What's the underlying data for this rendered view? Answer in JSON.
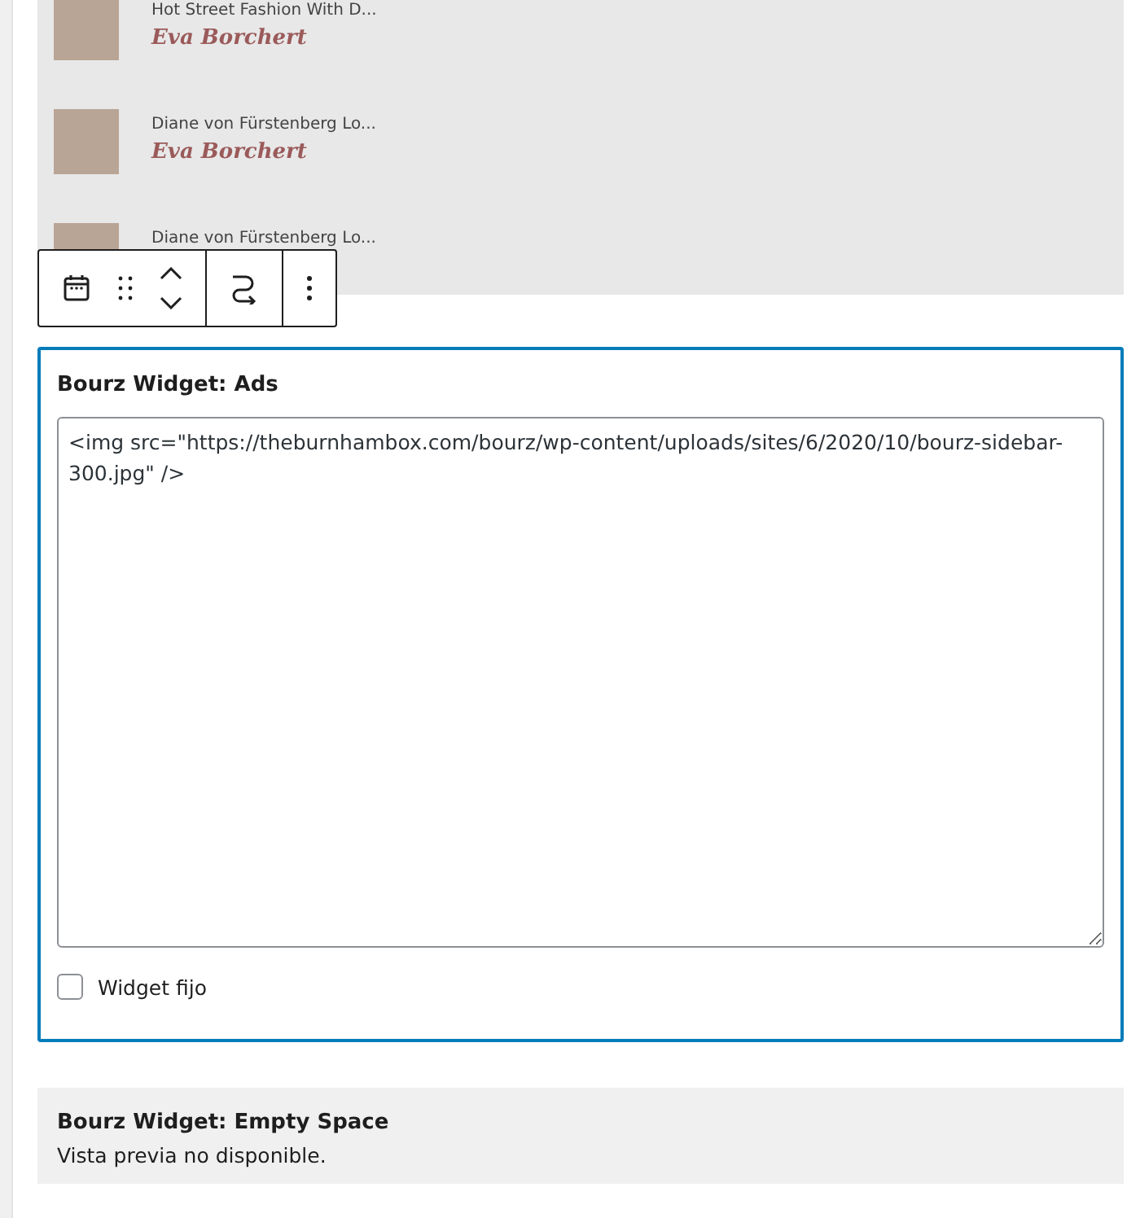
{
  "posts": [
    {
      "title": "Hot Street Fashion With D...",
      "author": "Eva Borchert"
    },
    {
      "title": "Diane von Fürstenberg Lo...",
      "author": "Eva Borchert"
    },
    {
      "title": "Diane von Fürstenberg Lo..."
    }
  ],
  "ads_widget": {
    "title": "Bourz Widget: Ads",
    "code": "<img src=\"https://theburnhambox.com/bourz/wp-content/uploads/sites/6/2020/10/bourz-sidebar-300.jpg\" />",
    "checkbox": {
      "label": "Widget fijo",
      "checked": false
    }
  },
  "empty_widget": {
    "title": "Bourz Widget: Empty Space",
    "message": "Vista previa no disponible."
  }
}
